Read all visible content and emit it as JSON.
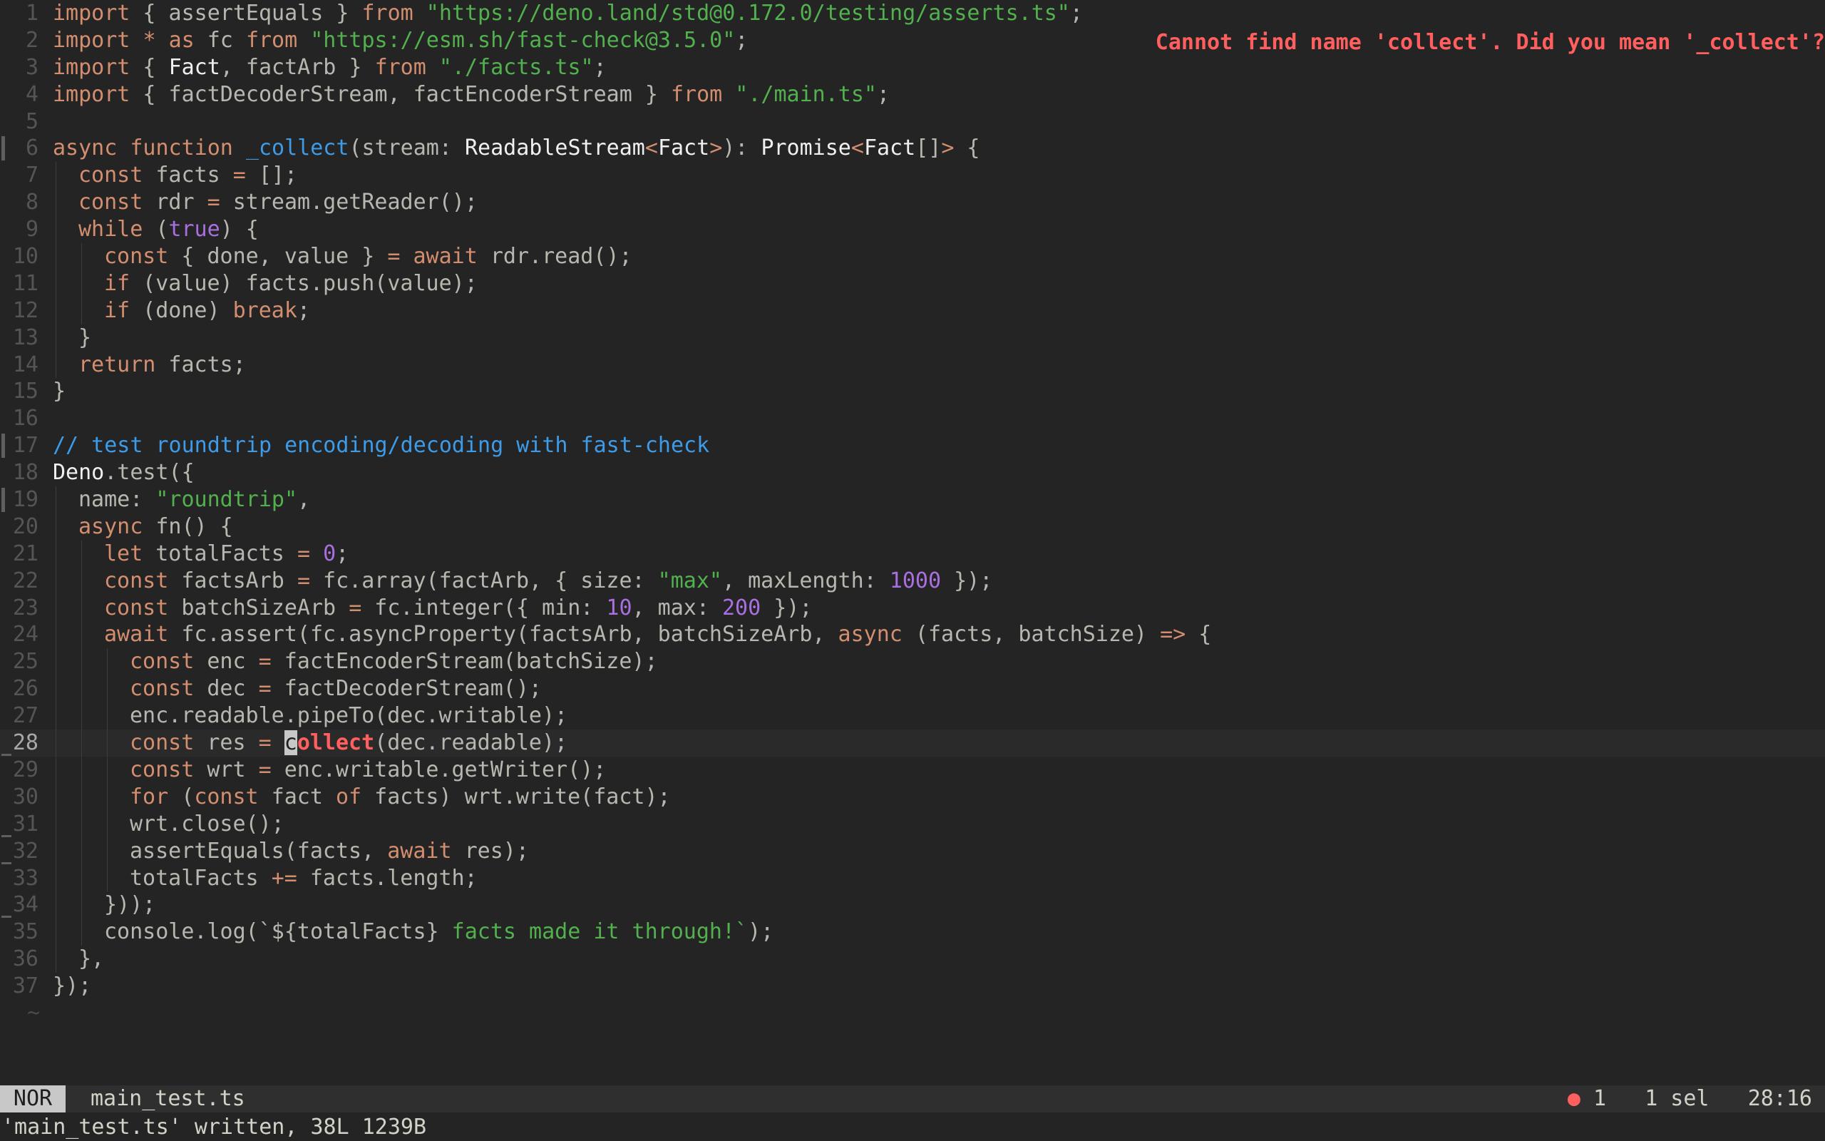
{
  "editor": {
    "mode": "NOR",
    "filename": "main_test.ts",
    "diagnostic_count": "1",
    "selection": "1 sel",
    "cursor_position": "28:16",
    "message": "'main_test.ts' written, 38L 1239B",
    "inline_diagnostic": "Cannot find name 'collect'. Did you mean '_collect'?",
    "error_line": 28,
    "current_line": 28,
    "error_color": "#ff5f5f",
    "keyword_color": "#d38d6f",
    "string_color": "#52b04e",
    "number_color": "#a96fe0",
    "function_color": "#3d9be8"
  },
  "code_lines": [
    [
      [
        "k",
        "import"
      ],
      [
        "p",
        " { assertEquals } "
      ],
      [
        "k",
        "from"
      ],
      [
        "p",
        " "
      ],
      [
        "s",
        "\"https://deno.land/std@0.172.0/testing/asserts.ts\""
      ],
      [
        "p",
        ";"
      ]
    ],
    [
      [
        "k",
        "import"
      ],
      [
        "p",
        " "
      ],
      [
        "k",
        "*"
      ],
      [
        "p",
        " "
      ],
      [
        "k",
        "as"
      ],
      [
        "p",
        " fc "
      ],
      [
        "k",
        "from"
      ],
      [
        "p",
        " "
      ],
      [
        "s",
        "\"https://esm.sh/fast-check@3.5.0\""
      ],
      [
        "p",
        ";"
      ]
    ],
    [
      [
        "k",
        "import"
      ],
      [
        "p",
        " { "
      ],
      [
        "t",
        "Fact"
      ],
      [
        "p",
        ", factArb } "
      ],
      [
        "k",
        "from"
      ],
      [
        "p",
        " "
      ],
      [
        "s",
        "\"./facts.ts\""
      ],
      [
        "p",
        ";"
      ]
    ],
    [
      [
        "k",
        "import"
      ],
      [
        "p",
        " { factDecoderStream, factEncoderStream } "
      ],
      [
        "k",
        "from"
      ],
      [
        "p",
        " "
      ],
      [
        "s",
        "\"./main.ts\""
      ],
      [
        "p",
        ";"
      ]
    ],
    [],
    [
      [
        "k",
        "async"
      ],
      [
        "p",
        " "
      ],
      [
        "k",
        "function"
      ],
      [
        "p",
        " "
      ],
      [
        "f",
        "_collect"
      ],
      [
        "p",
        "(stream: "
      ],
      [
        "t",
        "ReadableStream"
      ],
      [
        "k",
        "<"
      ],
      [
        "t",
        "Fact"
      ],
      [
        "k",
        ">"
      ],
      [
        "p",
        "): "
      ],
      [
        "t",
        "Promise"
      ],
      [
        "k",
        "<"
      ],
      [
        "t",
        "Fact"
      ],
      [
        "p",
        "[]"
      ],
      [
        "k",
        ">"
      ],
      [
        "p",
        " {"
      ]
    ],
    [
      [
        "k",
        "const"
      ],
      [
        "p",
        " facts "
      ],
      [
        "k",
        "="
      ],
      [
        "p",
        " [];"
      ]
    ],
    [
      [
        "k",
        "const"
      ],
      [
        "p",
        " rdr "
      ],
      [
        "k",
        "="
      ],
      [
        "p",
        " stream.getReader();"
      ]
    ],
    [
      [
        "k",
        "while"
      ],
      [
        "p",
        " ("
      ],
      [
        "n",
        "true"
      ],
      [
        "p",
        ") {"
      ]
    ],
    [
      [
        "k",
        "const"
      ],
      [
        "p",
        " { done, value } "
      ],
      [
        "k",
        "="
      ],
      [
        "p",
        " "
      ],
      [
        "k",
        "await"
      ],
      [
        "p",
        " rdr.read();"
      ]
    ],
    [
      [
        "k",
        "if"
      ],
      [
        "p",
        " (value) facts.push(value);"
      ]
    ],
    [
      [
        "k",
        "if"
      ],
      [
        "p",
        " (done) "
      ],
      [
        "k",
        "break"
      ],
      [
        "p",
        ";"
      ]
    ],
    [
      [
        "p",
        "}"
      ]
    ],
    [
      [
        "k",
        "return"
      ],
      [
        "p",
        " facts;"
      ]
    ],
    [
      [
        "p",
        "}"
      ]
    ],
    [],
    [
      [
        "c",
        "// test roundtrip encoding/decoding with fast-check"
      ]
    ],
    [
      [
        "t",
        "Deno"
      ],
      [
        "p",
        ".test({"
      ]
    ],
    [
      [
        "p",
        "name: "
      ],
      [
        "s",
        "\"roundtrip\""
      ],
      [
        "p",
        ","
      ]
    ],
    [
      [
        "k",
        "async"
      ],
      [
        "p",
        " fn() {"
      ]
    ],
    [
      [
        "k",
        "let"
      ],
      [
        "p",
        " totalFacts "
      ],
      [
        "k",
        "="
      ],
      [
        "p",
        " "
      ],
      [
        "n",
        "0"
      ],
      [
        "p",
        ";"
      ]
    ],
    [
      [
        "k",
        "const"
      ],
      [
        "p",
        " factsArb "
      ],
      [
        "k",
        "="
      ],
      [
        "p",
        " fc.array(factArb, { size: "
      ],
      [
        "s",
        "\"max\""
      ],
      [
        "p",
        ", maxLength: "
      ],
      [
        "n",
        "1000"
      ],
      [
        "p",
        " });"
      ]
    ],
    [
      [
        "k",
        "const"
      ],
      [
        "p",
        " batchSizeArb "
      ],
      [
        "k",
        "="
      ],
      [
        "p",
        " fc.integer({ min: "
      ],
      [
        "n",
        "10"
      ],
      [
        "p",
        ", max: "
      ],
      [
        "n",
        "200"
      ],
      [
        "p",
        " });"
      ]
    ],
    [
      [
        "k",
        "await"
      ],
      [
        "p",
        " fc.assert(fc.asyncProperty(factsArb, batchSizeArb, "
      ],
      [
        "k",
        "async"
      ],
      [
        "p",
        " (facts, batchSize) "
      ],
      [
        "k",
        "=>"
      ],
      [
        "p",
        " {"
      ]
    ],
    [
      [
        "k",
        "const"
      ],
      [
        "p",
        " enc "
      ],
      [
        "k",
        "="
      ],
      [
        "p",
        " factEncoderStream(batchSize);"
      ]
    ],
    [
      [
        "k",
        "const"
      ],
      [
        "p",
        " dec "
      ],
      [
        "k",
        "="
      ],
      [
        "p",
        " factDecoderStream();"
      ]
    ],
    [
      [
        "p",
        "enc.readable.pipeTo(dec.writable);"
      ]
    ],
    [
      [
        "k",
        "const"
      ],
      [
        "p",
        " res "
      ],
      [
        "k",
        "="
      ],
      [
        "p",
        " "
      ],
      [
        "cur",
        "c"
      ],
      [
        "err",
        "ollect"
      ],
      [
        "p",
        "(dec.readable);"
      ]
    ],
    [
      [
        "k",
        "const"
      ],
      [
        "p",
        " wrt "
      ],
      [
        "k",
        "="
      ],
      [
        "p",
        " enc.writable.getWriter();"
      ]
    ],
    [
      [
        "k",
        "for"
      ],
      [
        "p",
        " ("
      ],
      [
        "k",
        "const"
      ],
      [
        "p",
        " fact "
      ],
      [
        "k",
        "of"
      ],
      [
        "p",
        " facts) wrt.write(fact);"
      ]
    ],
    [
      [
        "p",
        "wrt.close();"
      ]
    ],
    [
      [
        "p",
        "assertEquals(facts, "
      ],
      [
        "k",
        "await"
      ],
      [
        "p",
        " res);"
      ]
    ],
    [
      [
        "p",
        "totalFacts "
      ],
      [
        "k",
        "+="
      ],
      [
        "p",
        " facts.length;"
      ]
    ],
    [
      [
        "p",
        "}));"
      ]
    ],
    [
      [
        "p",
        "console.log(`${totalFacts}"
      ],
      [
        "s",
        " facts made it through!`"
      ],
      [
        "p",
        ");"
      ]
    ],
    [
      [
        "p",
        "},"
      ]
    ],
    [
      [
        "p",
        "});"
      ]
    ]
  ],
  "line_numbers": [
    "1",
    "2",
    "3",
    "4",
    "5",
    "6",
    "7",
    "8",
    "9",
    "10",
    "11",
    "12",
    "13",
    "14",
    "15",
    "16",
    "17",
    "18",
    "19",
    "20",
    "21",
    "22",
    "23",
    "24",
    "25",
    "26",
    "27",
    "28",
    "29",
    "30",
    "31",
    "32",
    "33",
    "34",
    "35",
    "36",
    "37"
  ],
  "indent_levels": [
    0,
    0,
    0,
    0,
    0,
    0,
    1,
    1,
    1,
    2,
    2,
    2,
    1,
    1,
    0,
    0,
    0,
    0,
    1,
    1,
    2,
    2,
    2,
    2,
    3,
    3,
    3,
    3,
    3,
    3,
    3,
    3,
    3,
    2,
    2,
    1,
    0
  ],
  "gutter_modified": [
    6,
    17,
    19
  ],
  "gutter_deleted": [
    28,
    31,
    32,
    34
  ],
  "end_of_buffer": "~"
}
